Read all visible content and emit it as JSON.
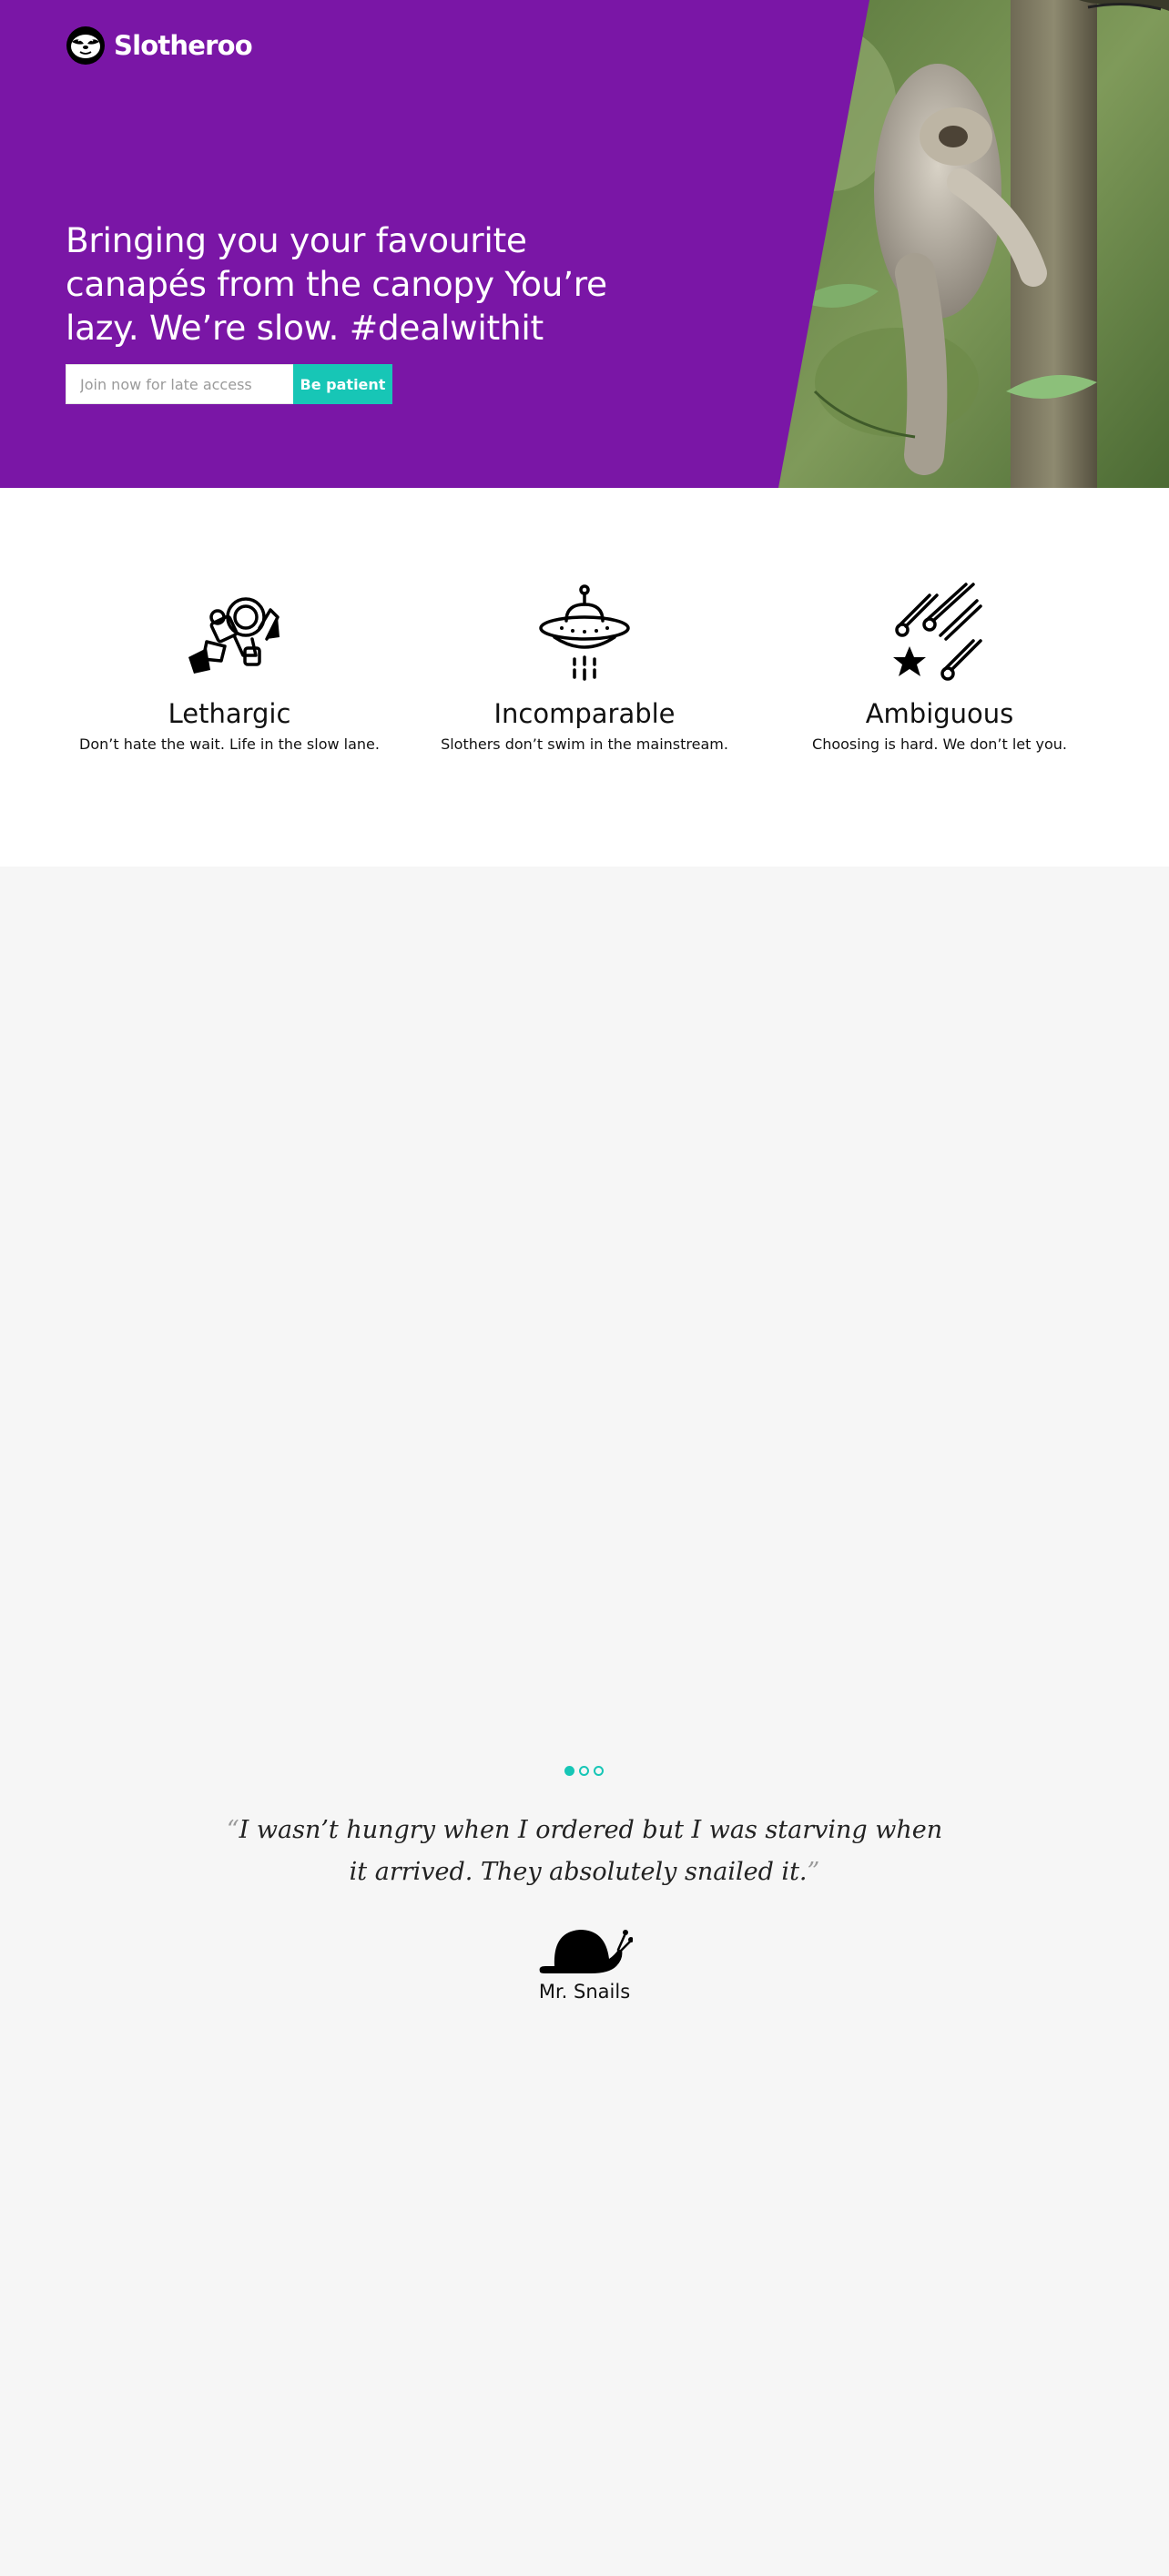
{
  "brand": {
    "name": "Slotheroo",
    "logo_icon": "sloth-face-icon"
  },
  "hero": {
    "headline": "Bringing you your favourite canapés from the canopy You’re lazy. We’re slow. #dealwithit",
    "signup": {
      "placeholder": "Join now for late access",
      "value": "",
      "button_label": "Be patient"
    },
    "image": "sloth-hanging-on-tree-photo"
  },
  "colors": {
    "hero_bg": "#7a16a6",
    "accent": "#17c6b6",
    "page_bg": "#f6f6f6",
    "features_bg": "#ffffff"
  },
  "features": [
    {
      "icon": "astronaut-icon",
      "title": "Lethargic",
      "text": "Don’t hate the wait. Life in the slow lane."
    },
    {
      "icon": "ufo-icon",
      "title": "Incomparable",
      "text": "Slothers don’t swim in the mainstream."
    },
    {
      "icon": "shooting-stars-icon",
      "title": "Ambiguous",
      "text": "Choosing is hard. We don’t let you."
    }
  ],
  "testimonials": {
    "dots_count": 3,
    "active_index": 0,
    "open_quote": "“",
    "close_quote": "”",
    "quote": "I wasn’t hungry when I ordered but I was starving when it arrived. They absolutely snailed it.",
    "author_icon": "snail-icon",
    "author": "Mr. Snails"
  }
}
